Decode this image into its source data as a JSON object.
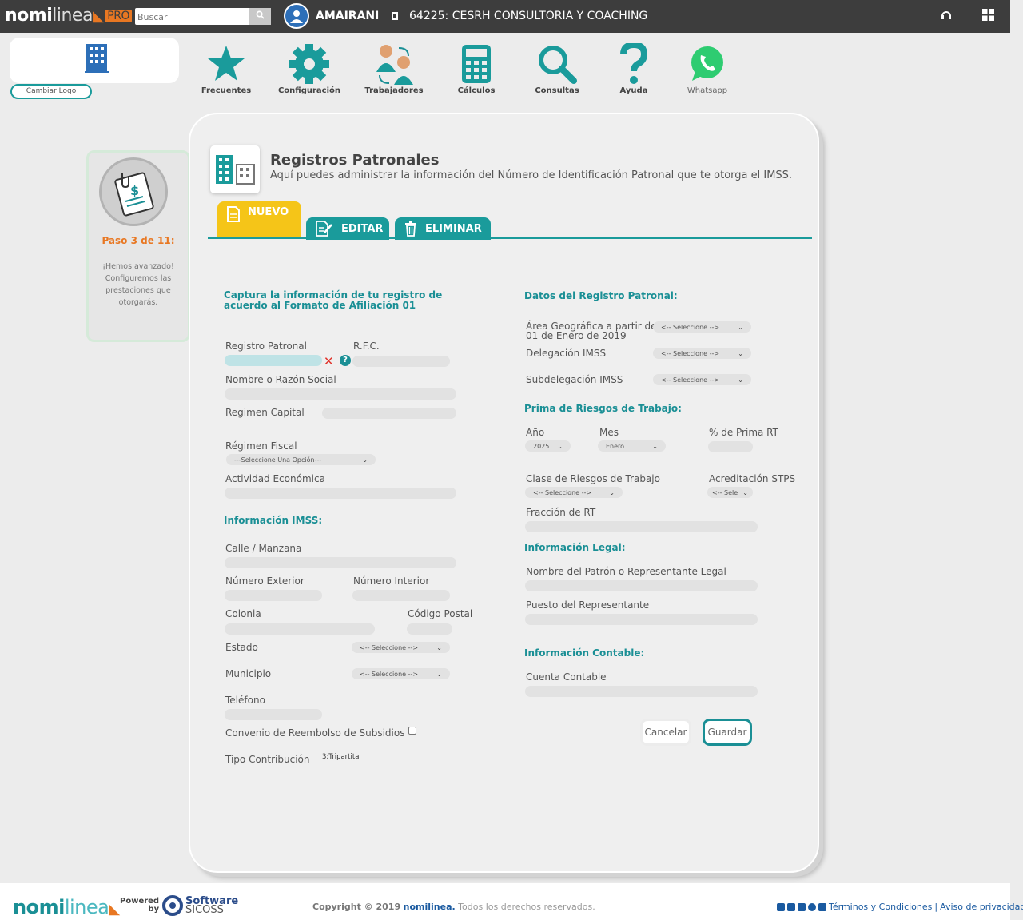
{
  "topbar": {
    "brand_bold": "nomi",
    "brand_light": "linea",
    "brand_pro": "PRO",
    "search_placeholder": "Buscar",
    "user_name": "AMAIRANI",
    "company": "64225: CESRH CONSULTORIA Y COACHING"
  },
  "logo": {
    "change_label": "Cambiar Logo"
  },
  "nav": [
    {
      "label": "Frecuentes",
      "icon": "star-icon"
    },
    {
      "label": "Configuración",
      "icon": "gear-icon"
    },
    {
      "label": "Trabajadores",
      "icon": "workers-icon"
    },
    {
      "label": "Cálculos",
      "icon": "calculator-icon"
    },
    {
      "label": "Consultas",
      "icon": "magnifier-icon"
    },
    {
      "label": "Ayuda",
      "icon": "question-icon"
    },
    {
      "label": "Whatsapp",
      "icon": "whatsapp-icon"
    }
  ],
  "step": {
    "progress": "Paso 3 de 11:",
    "message": "¡Hemos avanzado! Configuremos las prestaciones que otorgarás."
  },
  "header": {
    "title": "Registros Patronales",
    "subtitle": "Aquí puedes administrar la información del Número de Identificación Patronal que te otorga el IMSS."
  },
  "tabs": {
    "nuevo": "NUEVO",
    "editar": "EDITAR",
    "eliminar": "ELIMINAR"
  },
  "left": {
    "intro": "Captura la información de tu registro de acuerdo al Formato de Afiliación 01",
    "registro_patronal": "Registro Patronal",
    "rfc": "R.F.C.",
    "razon_social": "Nombre o Razón Social",
    "regimen_capital": "Regimen Capital",
    "regimen_fiscal": "Régimen Fiscal",
    "regimen_fiscal_value": "---Seleccione Una Opción---",
    "actividad": "Actividad Económica",
    "imss_title": "Información IMSS:",
    "calle": "Calle / Manzana",
    "num_ext": "Número Exterior",
    "num_int": "Número Interior",
    "colonia": "Colonia",
    "cp": "Código Postal",
    "estado": "Estado",
    "estado_value": "<-- Seleccione -->",
    "municipio": "Municipio",
    "municipio_value": "<-- Seleccione -->",
    "telefono": "Teléfono",
    "convenio": "Convenio de Reembolso de Subsidios",
    "tipo_contribucion": "Tipo Contribución",
    "tipo_contribucion_value": "3:Tripartita"
  },
  "right": {
    "datos_title": "Datos del Registro Patronal:",
    "area_geo_1": "Área Geográfica a partir del",
    "area_geo_2": "01 de Enero de 2019",
    "area_geo_value": "<-- Seleccione -->",
    "delegacion": "Delegación IMSS",
    "delegacion_value": "<-- Seleccione -->",
    "subdelegacion": "Subdelegación IMSS",
    "subdelegacion_value": "<-- Seleccione -->",
    "prima_title": "Prima de Riesgos de Trabajo:",
    "anio": "Año",
    "anio_value": "2025",
    "mes": "Mes",
    "mes_value": "Enero",
    "prima_rt": "% de Prima RT",
    "clase": "Clase de Riesgos de Trabajo",
    "clase_value": "<-- Seleccione -->",
    "acreditacion": "Acreditación STPS",
    "acreditacion_value": "<-- Sele",
    "fraccion": "Fracción de RT",
    "legal_title": "Información Legal:",
    "representante": "Nombre del Patrón o Representante Legal",
    "puesto": "Puesto del Representante",
    "contable_title": "Información Contable:",
    "cuenta": "Cuenta Contable",
    "cancel": "Cancelar",
    "save": "Guardar"
  },
  "footer": {
    "brand_bold": "nomi",
    "brand_light": "linea",
    "powered_1": "Powered",
    "powered_2": "by",
    "sicoss_1": "Software",
    "sicoss_2": "SICOSS",
    "copyright_pre": "Copyright © 2019",
    "copyright_brand": "nomilinea.",
    "copyright_post": "Todos los derechos reservados.",
    "terms": "Términos y Condiciones",
    "separator": "|",
    "privacy": "Aviso de privacidad"
  },
  "colors": {
    "teal": "#1a9b9b",
    "yellow": "#f5c518",
    "orange": "#e87722",
    "topbar": "#3d3d3d"
  }
}
